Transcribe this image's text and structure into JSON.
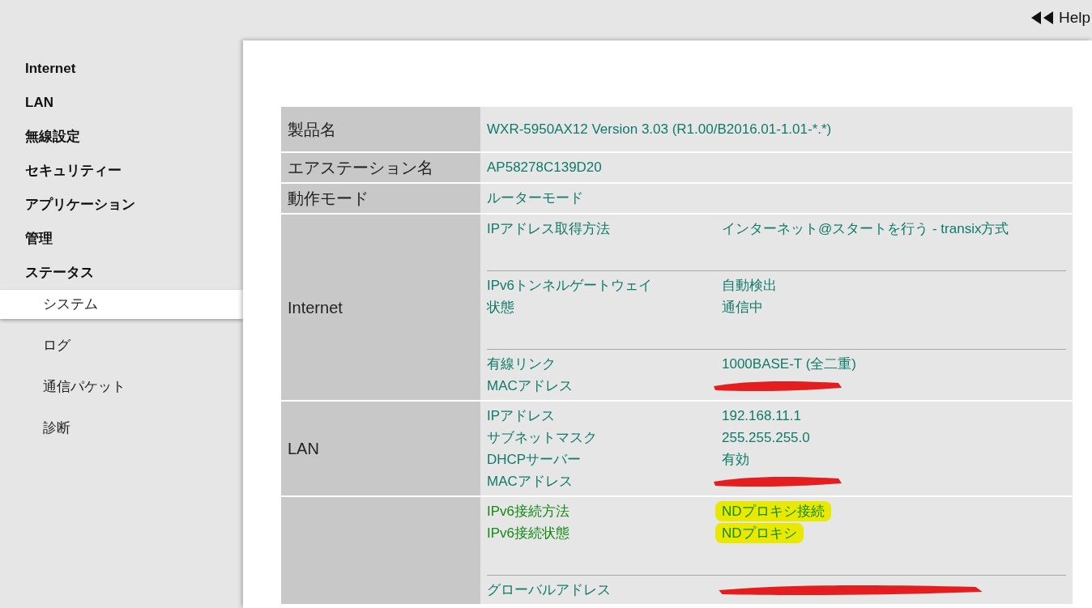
{
  "header": {
    "help_link": "Help"
  },
  "sidebar": {
    "items": [
      {
        "label": "Internet",
        "kind": "section",
        "selected": false
      },
      {
        "label": "LAN",
        "kind": "section",
        "selected": false
      },
      {
        "label": "無線設定",
        "kind": "section",
        "selected": false
      },
      {
        "label": "セキュリティー",
        "kind": "section",
        "selected": false
      },
      {
        "label": "アプリケーション",
        "kind": "section",
        "selected": false
      },
      {
        "label": "管理",
        "kind": "section",
        "selected": false
      },
      {
        "label": "ステータス",
        "kind": "section",
        "selected": false
      },
      {
        "label": "システム",
        "kind": "subitem",
        "selected": true
      },
      {
        "label": "ログ",
        "kind": "subitem",
        "selected": false
      },
      {
        "label": "通信パケット",
        "kind": "subitem",
        "selected": false
      },
      {
        "label": "診断",
        "kind": "subitem",
        "selected": false
      }
    ]
  },
  "table": {
    "rows": [
      {
        "kind": "simple",
        "label": "製品名",
        "value": "WXR-5950AX12  Version 3.03 (R1.00/B2016.01-1.01-*.*)"
      },
      {
        "kind": "simple",
        "label": "エアステーション名",
        "value": "AP58278C139D20"
      },
      {
        "kind": "simple",
        "label": "動作モード",
        "value": "ルーターモード"
      },
      {
        "kind": "grouped",
        "label": "Internet",
        "groups": [
          [
            {
              "label": "IPアドレス取得方法",
              "value": "インターネット@スタートを行う - transix方式",
              "redacted": false,
              "highlighted": false
            }
          ],
          [
            {
              "label": "IPv6トンネルゲートウェイ",
              "value": "自動検出",
              "redacted": false,
              "highlighted": false
            },
            {
              "label": "状態",
              "value": "通信中",
              "redacted": false,
              "highlighted": false
            }
          ],
          [
            {
              "label": "有線リンク",
              "value": "1000BASE-T (全二重)",
              "redacted": false,
              "highlighted": false
            },
            {
              "label": "MACアドレス",
              "redacted": true
            }
          ]
        ]
      },
      {
        "kind": "grouped",
        "label": "LAN",
        "groups": [
          [
            {
              "label": "IPアドレス",
              "value": "192.168.11.1",
              "redacted": false,
              "highlighted": false
            },
            {
              "label": "サブネットマスク",
              "value": "255.255.255.0",
              "redacted": false,
              "highlighted": false
            },
            {
              "label": "DHCPサーバー",
              "value": "有効",
              "redacted": false,
              "highlighted": false
            },
            {
              "label": "MACアドレス",
              "redacted": true
            }
          ]
        ]
      },
      {
        "kind": "grouped",
        "groups": [
          [
            {
              "label": "IPv6接続方法",
              "value": "NDプロキシ接続",
              "redacted": false,
              "highlighted": true
            },
            {
              "label": "IPv6接続状態",
              "value": "NDプロキシ",
              "redacted": false,
              "highlighted": true
            }
          ],
          [
            {
              "label": "グローバルアドレス",
              "redacted": true
            }
          ]
        ]
      }
    ]
  }
}
